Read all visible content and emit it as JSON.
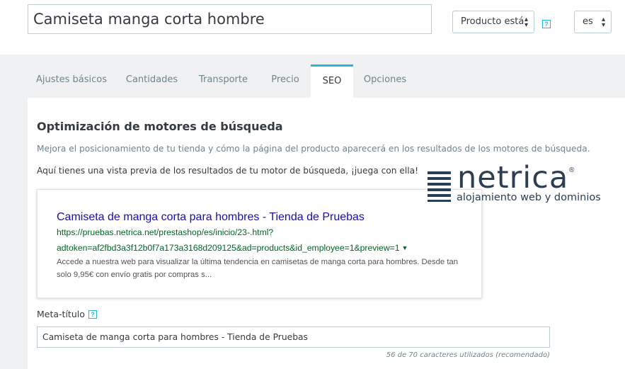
{
  "header": {
    "product_name": "Camiseta manga corta hombre",
    "product_type": "Producto está",
    "language": "es",
    "help_glyph": "?"
  },
  "tabs": [
    {
      "label": "Ajustes básicos",
      "active": false
    },
    {
      "label": "Cantidades",
      "active": false
    },
    {
      "label": "Transporte",
      "active": false
    },
    {
      "label": "Precio",
      "active": false
    },
    {
      "label": "SEO",
      "active": true
    },
    {
      "label": "Opciones",
      "active": false
    }
  ],
  "seo": {
    "title": "Optimización de motores de búsqueda",
    "description": "Mejora el posicionamiento de tu tienda y cómo la página del producto aparecerá en los resultados de los motores de búsqueda.",
    "preview_intro": "Aquí tienes una vista previa de los resultados de tu motor de búsqueda, ¡juega con ella!",
    "preview": {
      "title": "Camiseta de manga corta para hombres - Tienda de Pruebas",
      "url_line1": "https://pruebas.netrica.net/prestashop/es/inicio/23-.html?",
      "url_line2": "adtoken=af2fbd3a3f12b0f7a173a3168d209125&ad=products&id_employee=1&preview=1",
      "description": "Accede a nuestra web para visualizar la última tendencia en camisetas de manga corta para hombres. Desde tan solo 9,95€ con envío gratis por compras s..."
    },
    "meta_title": {
      "label": "Meta-título",
      "value": "Camiseta de manga corta para hombres - Tienda de Pruebas",
      "counter": "56 de 70 caracteres utilizados (recomendado)"
    }
  },
  "watermark": {
    "brand": "netrica",
    "registered": "®",
    "tagline": "alojamiento web y dominios",
    "color": "#2c3e52"
  },
  "colors": {
    "accent": "#25b9d7",
    "link": "#1a0dab",
    "url": "#006621",
    "band": "#eff1f2"
  },
  "icons": [
    "help-icon",
    "select-arrows-icon",
    "url-dropdown-caret-icon",
    "netrica-logo-icon"
  ]
}
